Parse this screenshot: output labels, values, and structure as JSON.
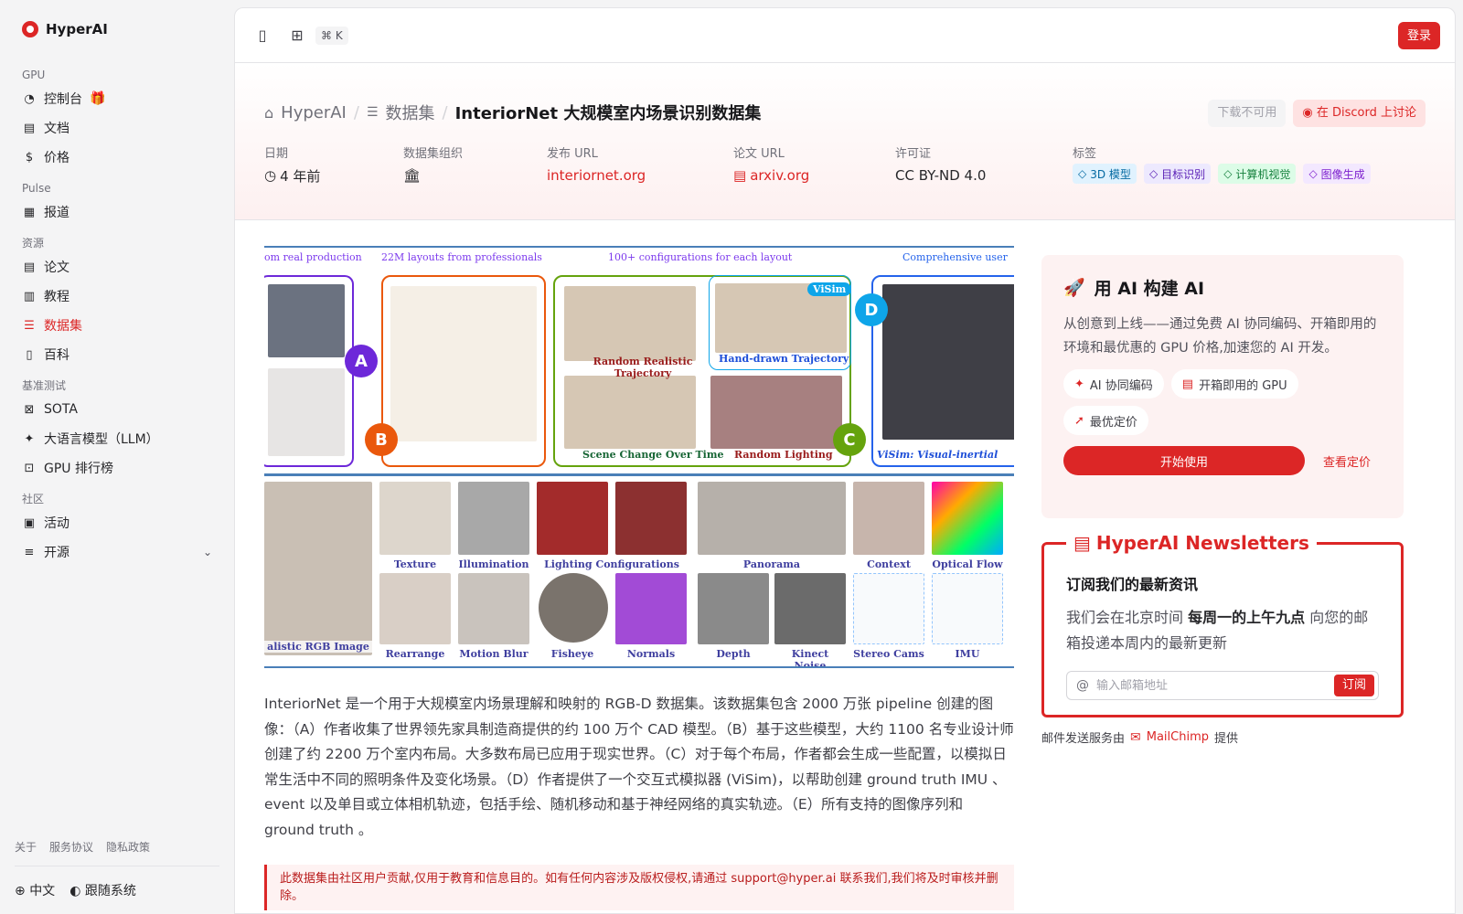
{
  "sidebar": {
    "brand": "HyperAI",
    "groups": [
      {
        "label": "GPU",
        "items": [
          {
            "label": "控制台"
          },
          {
            "label": "文档"
          },
          {
            "label": "价格"
          }
        ]
      },
      {
        "label": "Pulse",
        "items": [
          {
            "label": "报道"
          }
        ]
      },
      {
        "label": "资源",
        "items": [
          {
            "label": "论文"
          },
          {
            "label": "教程"
          },
          {
            "label": "数据集"
          },
          {
            "label": "百科"
          }
        ]
      },
      {
        "label": "基准测试",
        "items": [
          {
            "label": "SOTA"
          },
          {
            "label": "大语言模型（LLM）"
          },
          {
            "label": "GPU 排行榜"
          }
        ]
      },
      {
        "label": "社区",
        "items": [
          {
            "label": "活动"
          },
          {
            "label": "开源"
          }
        ]
      }
    ],
    "footer_links": [
      "关于",
      "服务协议",
      "隐私政策"
    ],
    "language": "中文",
    "theme": "跟随系统"
  },
  "topbar": {
    "shortcut": "⌘ K",
    "login": "登录"
  },
  "breadcrumb": {
    "home": "HyperAI",
    "section": "数据集",
    "current": "InteriorNet 大规模室内场景识别数据集"
  },
  "header_actions": {
    "download": "下载不可用",
    "discord": "在 Discord 上讨论"
  },
  "meta": {
    "date_label": "日期",
    "date_value": "4 年前",
    "org_label": "数据集组织",
    "release_label": "发布 URL",
    "release_value": "interiornet.org",
    "paper_label": "论文 URL",
    "paper_value": "arxiv.org",
    "license_label": "许可证",
    "license_value": "CC BY-ND 4.0",
    "tags_label": "标签",
    "tags": [
      "3D 模型",
      "目标识别",
      "计算机视觉",
      "图像生成"
    ]
  },
  "figure": {
    "headers": [
      "om real production",
      "22M layouts from professionals",
      "100+ configurations for each layout",
      "Comprehensive user"
    ],
    "panel_labels": [
      "Random Realistic Trajectory",
      "Hand-drawn Trajectory",
      "Scene Change Over Time",
      "Random Lighting",
      "ViSim: Visual-inertial"
    ],
    "badges": [
      "A",
      "B",
      "C",
      "D",
      "ViSim"
    ],
    "captions_row1": [
      "Texture",
      "Illumination",
      "Lighting Configurations",
      "Panorama",
      "Context",
      "Optical Flow"
    ],
    "captions_row2": [
      "alistic RGB Image",
      "Rearrange",
      "Motion Blur",
      "Fisheye",
      "Normals",
      "Depth",
      "Kinect Noise",
      "Stereo Cams",
      "IMU"
    ]
  },
  "description": "InteriorNet 是一个用于大规模室内场景理解和映射的 RGB-D 数据集。该数据集包含 2000 万张 pipeline 创建的图像：（A）作者收集了世界领先家具制造商提供的约 100 万个 CAD 模型。（B）基于这些模型，大约 1100 名专业设计师创建了约 2200 万个室内布局。大多数布局已应用于现实世界。（C）对于每个布局，作者都会生成一些配置，以模拟日常生活中不同的照明条件及变化场景。（D）作者提供了一个交互式模拟器 (ViSim)，以帮助创建 ground truth IMU 、 event 以及单目或立体相机轨迹，包括手绘、随机移动和基于神经网络的真实轨迹。（E）所有支持的图像序列和 ground truth 。",
  "notice": {
    "before": "此数据集由社区用户贡献,仅用于教育和信息目的。如有任何内容涉及版权侵权,请通过",
    "email": "support@hyper.ai",
    "after": "联系我们,我们将及时审核并删除。"
  },
  "promo": {
    "title": "用 AI 构建 AI",
    "description": "从创意到上线——通过免费 AI 协同编码、开箱即用的环境和最优惠的 GPU 价格,加速您的 AI 开发。",
    "features": [
      "AI 协同编码",
      "开箱即用的 GPU",
      "最优定价"
    ],
    "start": "开始使用",
    "pricing": "查看定价"
  },
  "newsletter": {
    "legend": "HyperAI Newsletters",
    "heading": "订阅我们的最新资讯",
    "desc_before": "我们会在北京时间",
    "desc_bold": "每周一的上午九点",
    "desc_after": "向您的邮箱投递本周内的最新更新",
    "placeholder": "输入邮箱地址",
    "subscribe": "订阅",
    "footer_before": "邮件发送服务由",
    "footer_brand": "MailChimp",
    "footer_after": "提供"
  },
  "colors": {
    "accent": "#dc2626",
    "tag_3d": "#e0f2fe",
    "tag_obj": "#ede9fe",
    "tag_cv": "#dcfce7",
    "tag_gen": "#f3e8ff"
  }
}
